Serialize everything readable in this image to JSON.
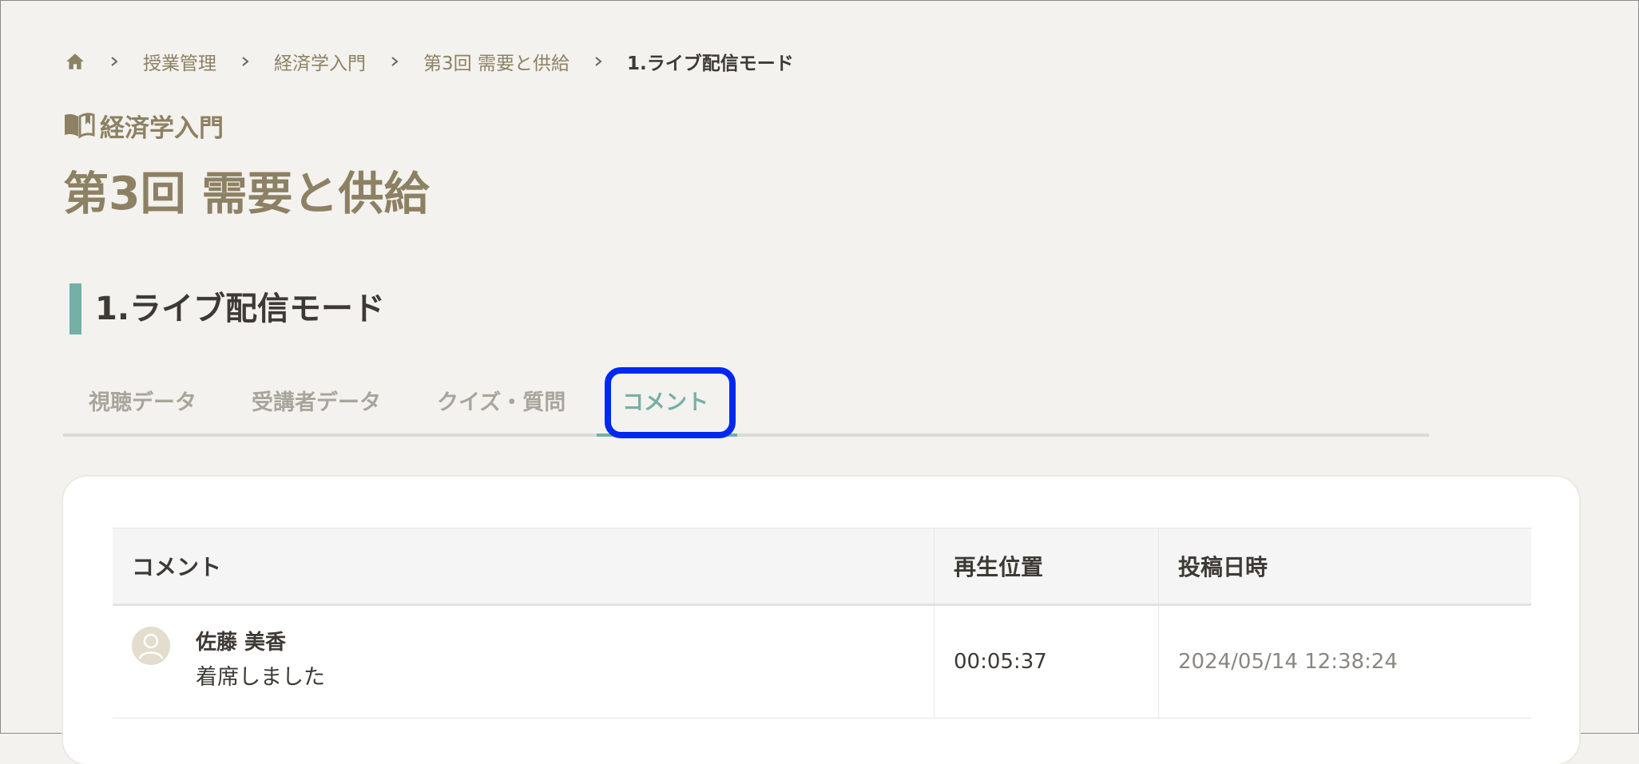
{
  "breadcrumb": {
    "home_icon": "home-icon",
    "items": [
      "授業管理",
      "経済学入門",
      "第3回 需要と供給",
      "1.ライブ配信モード"
    ]
  },
  "course": {
    "icon": "book-icon",
    "name": "経済学入門"
  },
  "page_title": "第3回 需要と供給",
  "section_title": "1.ライブ配信モード",
  "tabs": [
    {
      "label": "視聴データ",
      "active": false
    },
    {
      "label": "受講者データ",
      "active": false
    },
    {
      "label": "クイズ・質問",
      "active": false
    },
    {
      "label": "コメント",
      "active": true
    }
  ],
  "table": {
    "headers": [
      "コメント",
      "再生位置",
      "投稿日時"
    ],
    "rows": [
      {
        "author": "佐藤 美香",
        "comment": "着席しました",
        "position": "00:05:37",
        "posted_at": "2024/05/14 12:38:24"
      }
    ]
  },
  "colors": {
    "accent": "#74b0a6",
    "brand_text": "#8d8163",
    "highlight": "#0028ef",
    "background": "#f3f2ef"
  }
}
